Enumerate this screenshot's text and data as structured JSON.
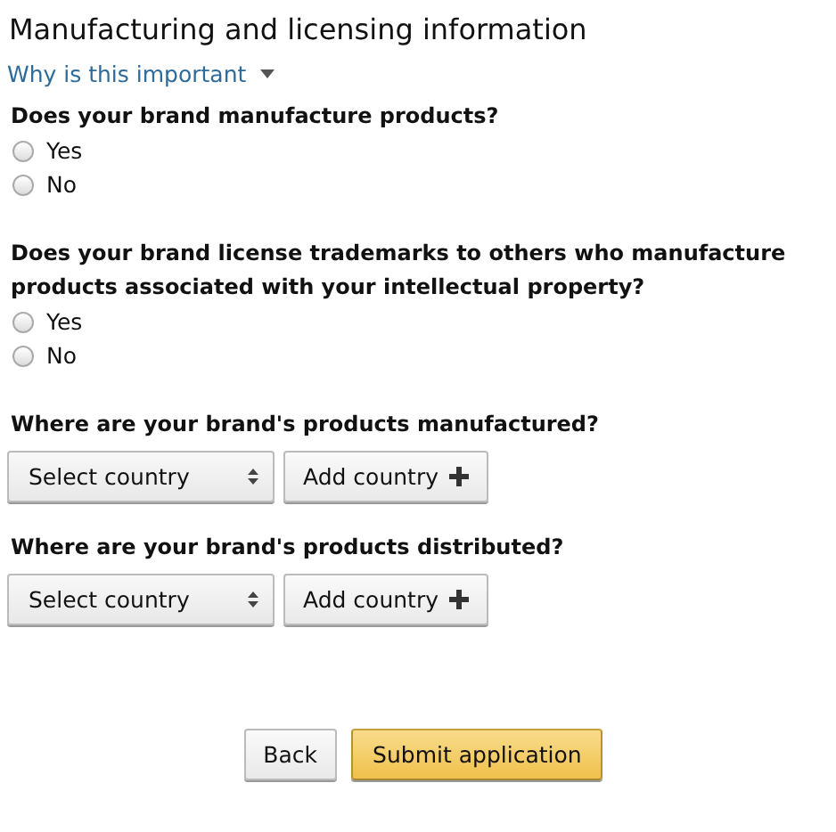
{
  "title": "Manufacturing and licensing information",
  "help_link": {
    "label": "Why is this important",
    "expanded": false
  },
  "questions": [
    {
      "kind": "radio",
      "label": "Does your brand manufacture products?",
      "options": [
        {
          "label": "Yes",
          "selected": false
        },
        {
          "label": "No",
          "selected": false
        }
      ]
    },
    {
      "kind": "radio",
      "label": "Does your brand license trademarks to others who manufacture products associated with your intellectual property?",
      "options": [
        {
          "label": "Yes",
          "selected": false
        },
        {
          "label": "No",
          "selected": false
        }
      ]
    },
    {
      "kind": "country",
      "label": "Where are your brand's products manufactured?",
      "select": "Select country",
      "button": "Add country"
    },
    {
      "kind": "country",
      "label": "Where are your brand's products distributed?",
      "select": "Select country",
      "button": "Add country"
    }
  ],
  "buttons": [
    {
      "label": "Back",
      "kind": "secondary"
    },
    {
      "label": "Submit application",
      "kind": "primary"
    }
  ]
}
